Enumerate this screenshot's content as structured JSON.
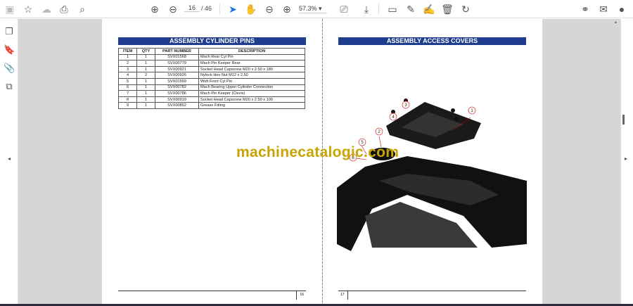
{
  "toolbar": {
    "page_current": "16",
    "page_total": "/ 46",
    "zoom": "57.3%"
  },
  "left_page": {
    "title": "ASSEMBLY CYLINDER PINS",
    "columns": [
      "ITEM",
      "QTY",
      "PART NUMBER",
      "DESCRIPTION"
    ],
    "rows": [
      [
        "1",
        "1",
        "SVX01568",
        "Mach Rear Cyl Pin"
      ],
      [
        "2",
        "1",
        "SVX00779",
        "Mach Pin Keeper Rear"
      ],
      [
        "3",
        "1",
        "SVX00921",
        "Socket Head Capscrew M20 x 2.50 x 180"
      ],
      [
        "4",
        "2",
        "SVX00926",
        "Nylock Hex Nut M12 x 2.50"
      ],
      [
        "5",
        "1",
        "SVX01569",
        "Widt Front Cyl Pin"
      ],
      [
        "6",
        "1",
        "SVX00782",
        "Mach Bearing Upper Cylinder Connection"
      ],
      [
        "7",
        "1",
        "SVX00786",
        "Mach Pin Keeper (Clevis)"
      ],
      [
        "8",
        "1",
        "SVX00919",
        "Socket Head Capscrew M20 x 2.50 x 100"
      ],
      [
        "9",
        "1",
        "SVX00852",
        "Grease Fitting"
      ]
    ],
    "page_number": "16"
  },
  "right_page": {
    "title": "ASSEMBLY ACCESS COVERS",
    "callouts": [
      "1",
      "2",
      "3",
      "4",
      "5",
      "6"
    ],
    "page_number": "17"
  },
  "watermark": "machinecatalogic.com"
}
